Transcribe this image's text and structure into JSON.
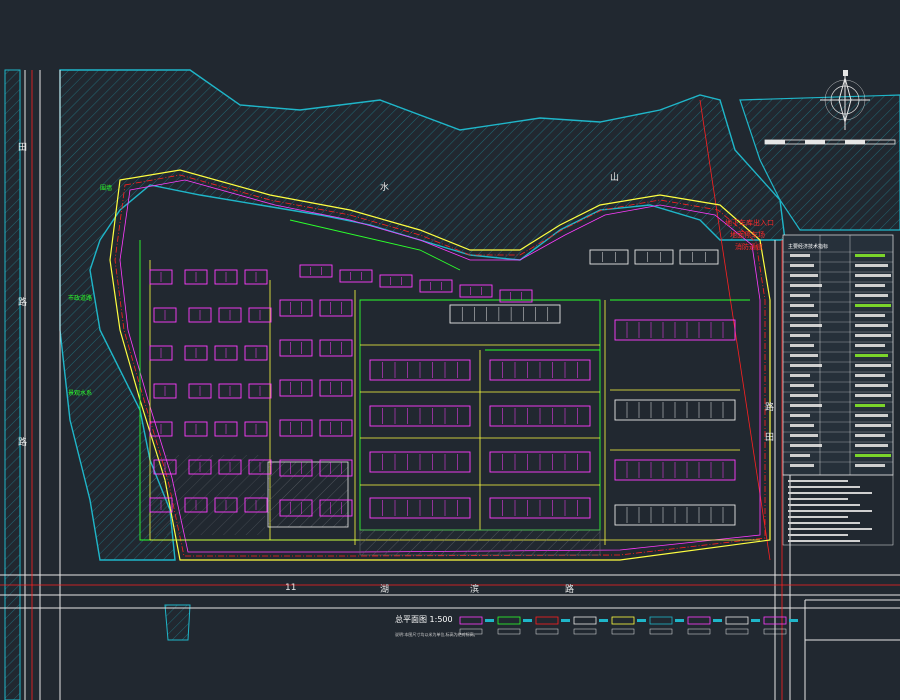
{
  "drawing": {
    "title": "总平面图 1:500",
    "red_labels": [
      "地下车库出入口",
      "地面停车场",
      "消防通道"
    ],
    "green_labels": [
      "景观水系",
      "市政道路",
      "围墙"
    ],
    "road_labels": [
      "田",
      "路",
      "路",
      "路",
      "田",
      "湖",
      "滨",
      "路",
      "水",
      "山",
      "11"
    ],
    "legend_note": "说明:本图尺寸均以米为单位,标高为绝对标高。"
  },
  "colors": {
    "background": "#212830",
    "water": "#1fb6c9",
    "building": "#ff3cff",
    "road_edge": "#ffff40",
    "boundary_red": "#ff2020",
    "green_line": "#2cff2c",
    "white_line": "#e6e6e6"
  },
  "data_table": {
    "title": "主要经济技术指标"
  },
  "north_arrow": {
    "name": "north-arrow-icon"
  }
}
